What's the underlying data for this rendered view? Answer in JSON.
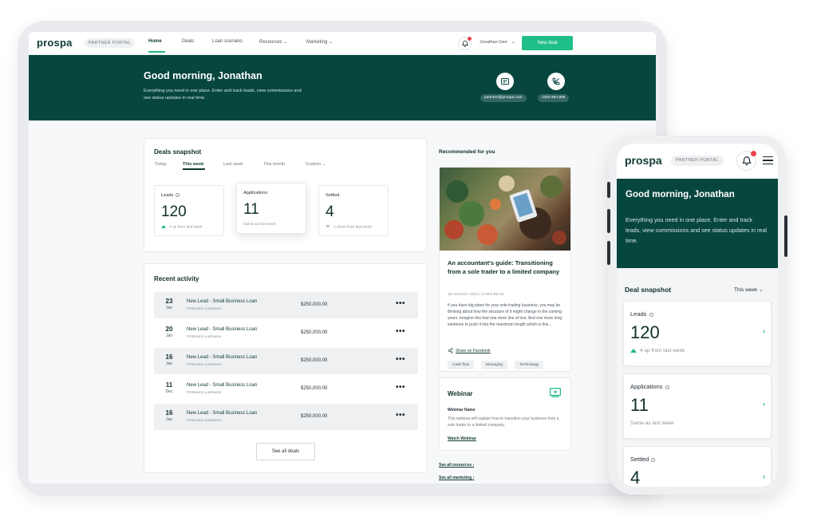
{
  "desktop": {
    "nav": {
      "logo": "prospa",
      "portal_badge": "PARTNER PORTAL",
      "links": [
        "Home",
        "Deals",
        "Loan scenario",
        "Resources ⌄",
        "Marketing ⌄"
      ],
      "user_name": "Jonathan Garr",
      "user_chevron": "⌄",
      "new_deal": "New deal"
    },
    "hero": {
      "title": "Good morning, Jonathan",
      "subtitle": "Everything you need in one place. Enter and track leads, view commissions and see status updates in real time.",
      "email": "partners@prospa.com",
      "phone": "1300 964 808"
    },
    "snapshot": {
      "title": "Deals snapshot",
      "tabs": [
        "Today",
        "This week",
        "Last week",
        "This month",
        "Custom ⌄"
      ],
      "stats": [
        {
          "label": "Leads",
          "value": "120",
          "note": "4 up from last week"
        },
        {
          "label": "Applications",
          "value": "11",
          "note": "Same as last week"
        },
        {
          "label": "Settled",
          "value": "4",
          "note": "2 down from last week"
        }
      ]
    },
    "activity": {
      "title": "Recent activity",
      "rows": [
        {
          "day": "23",
          "month": "Jan",
          "title": "New Lead - Small Business Loan",
          "sub": "Firstname Lastname",
          "amount": "$250,000.00"
        },
        {
          "day": "20",
          "month": "Jan",
          "title": "New Lead - Small Business Loan",
          "sub": "Firstname Lastname",
          "amount": "$250,000.00"
        },
        {
          "day": "16",
          "month": "Jan",
          "title": "New Lead - Small Business Loan",
          "sub": "Firstname Lastname",
          "amount": "$250,000.00"
        },
        {
          "day": "11",
          "month": "Dec",
          "title": "New Lead - Small Business Loan",
          "sub": "Firstname Lastname",
          "amount": "$250,000.00"
        },
        {
          "day": "16",
          "month": "Jan",
          "title": "New Lead - Small Business Loan",
          "sub": "Firstname Lastname",
          "amount": "$250,000.00"
        }
      ],
      "more": "•••",
      "see_all": "See all deals"
    },
    "recommended": {
      "heading": "Recommended for you",
      "article": {
        "title": "An accountant's guide: Transitioning from a sole trader to a limited company",
        "meta": "28 AUGUST 2019 | 6 MIN READ",
        "body": "If you have big plans for your sole trading business, you may be thinking about how the structure of it might change in the coming years. Imagine this had one more line of text. And one more long sentence to push it into the maximum length which is this...",
        "share": "Share on Facebook",
        "tags": [
          "Cash flow",
          "Managing",
          "Technology"
        ]
      },
      "webinar": {
        "title": "Webinar",
        "name": "Webinar Name",
        "desc": "This webinar will explain how to transition your business from a sole trader to a limited company.",
        "link": "Watch Webinar"
      },
      "see_resources": "See all resources ›",
      "see_marketing": "See all marketing ›"
    }
  },
  "mobile": {
    "logo": "prospa",
    "portal_badge": "PARTNER PORTAL",
    "hero_title": "Good morning, Jonathan",
    "hero_subtitle": "Everything you need in one place. Enter and track leads, view commissions and see status updates in real time.",
    "snapshot_title": "Deal snapshot",
    "snapshot_period": "This week ⌄",
    "chevron": "›",
    "stats": [
      {
        "label": "Leads",
        "value": "120",
        "note": "4 up from last week"
      },
      {
        "label": "Applications",
        "value": "11",
        "note": "Same as last week"
      },
      {
        "label": "Settled",
        "value": "4",
        "note": ""
      }
    ]
  },
  "colors": {
    "brand_dark": "#06463f",
    "accent_green": "#1fbf8a",
    "notification_red": "#e8434b"
  }
}
